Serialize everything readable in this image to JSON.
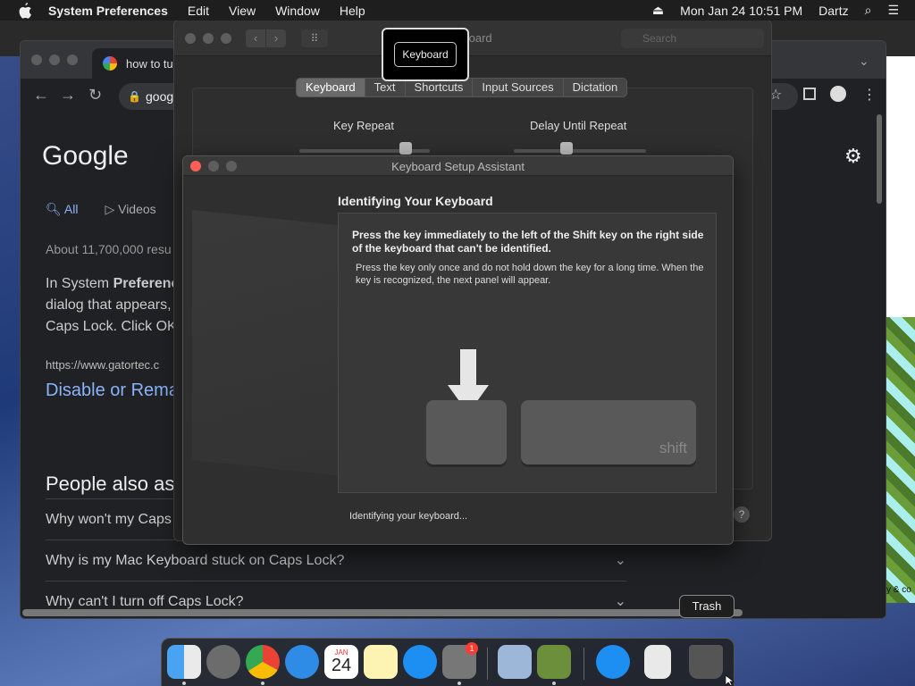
{
  "menubar": {
    "app_name": "System Preferences",
    "menus": [
      "Edit",
      "View",
      "Window",
      "Help"
    ],
    "clock": "Mon Jan 24  10:51 PM",
    "user": "Dartz"
  },
  "chrome": {
    "tab_title": "how to tur",
    "omnibox_text": "goog",
    "logo": "Google",
    "search_tabs": [
      {
        "label": "All",
        "icon": "search-icon"
      },
      {
        "label": "Videos",
        "icon": "video-icon"
      }
    ],
    "results_count": "About 11,700,000 resu",
    "snippet_line1_prefix": "In System ",
    "snippet_line1_bold": "Preferenc",
    "snippet_line2": "dialog that appears,",
    "snippet_line3": "Caps Lock. Click OK",
    "result_url": "https://www.gatortec.c",
    "result_title": "Disable or Rema",
    "paa_title": "People also as",
    "paa_items": [
      "Why won't my Caps",
      "Why is my Mac Keyboard stuck on Caps Lock?",
      "Why can't I turn off Caps Lock?"
    ]
  },
  "syspref": {
    "title": "Keyboard",
    "search_placeholder": "Search",
    "tabs": [
      "Keyboard",
      "Text",
      "Shortcuts",
      "Input Sources",
      "Dictation"
    ],
    "selected_tab": "Keyboard",
    "key_repeat_label": "Key Repeat",
    "delay_label": "Delay Until Repeat",
    "help": "?"
  },
  "tooltip_keyboard": "Keyboard",
  "ksa": {
    "title": "Keyboard Setup Assistant",
    "heading": "Identifying Your Keyboard",
    "instruction_bold": "Press the key immediately to the left of the Shift key on the right side of the keyboard that can't be identified.",
    "instruction": "Press the key only once and do not hold down the key for a long time. When the key is recognized, the next panel will appear.",
    "shift_label": "shift",
    "status": "Identifying your keyboard..."
  },
  "dock": {
    "trash_tooltip": "Trash",
    "calendar_month": "JAN",
    "calendar_day": "24",
    "syspref_badge": "1",
    "apps": [
      "Finder",
      "Launchpad",
      "Chrome",
      "Safari",
      "Calendar",
      "Notes",
      "App Store",
      "System Preferences",
      "Preview",
      "Minecraft",
      "App Store Folder",
      "Document",
      "Trash"
    ]
  },
  "desktop_right_text": "y & co",
  "colors": {
    "link": "#8ab4f8",
    "close_red": "#ff5f57",
    "dock_badge": "#ff3b30"
  }
}
